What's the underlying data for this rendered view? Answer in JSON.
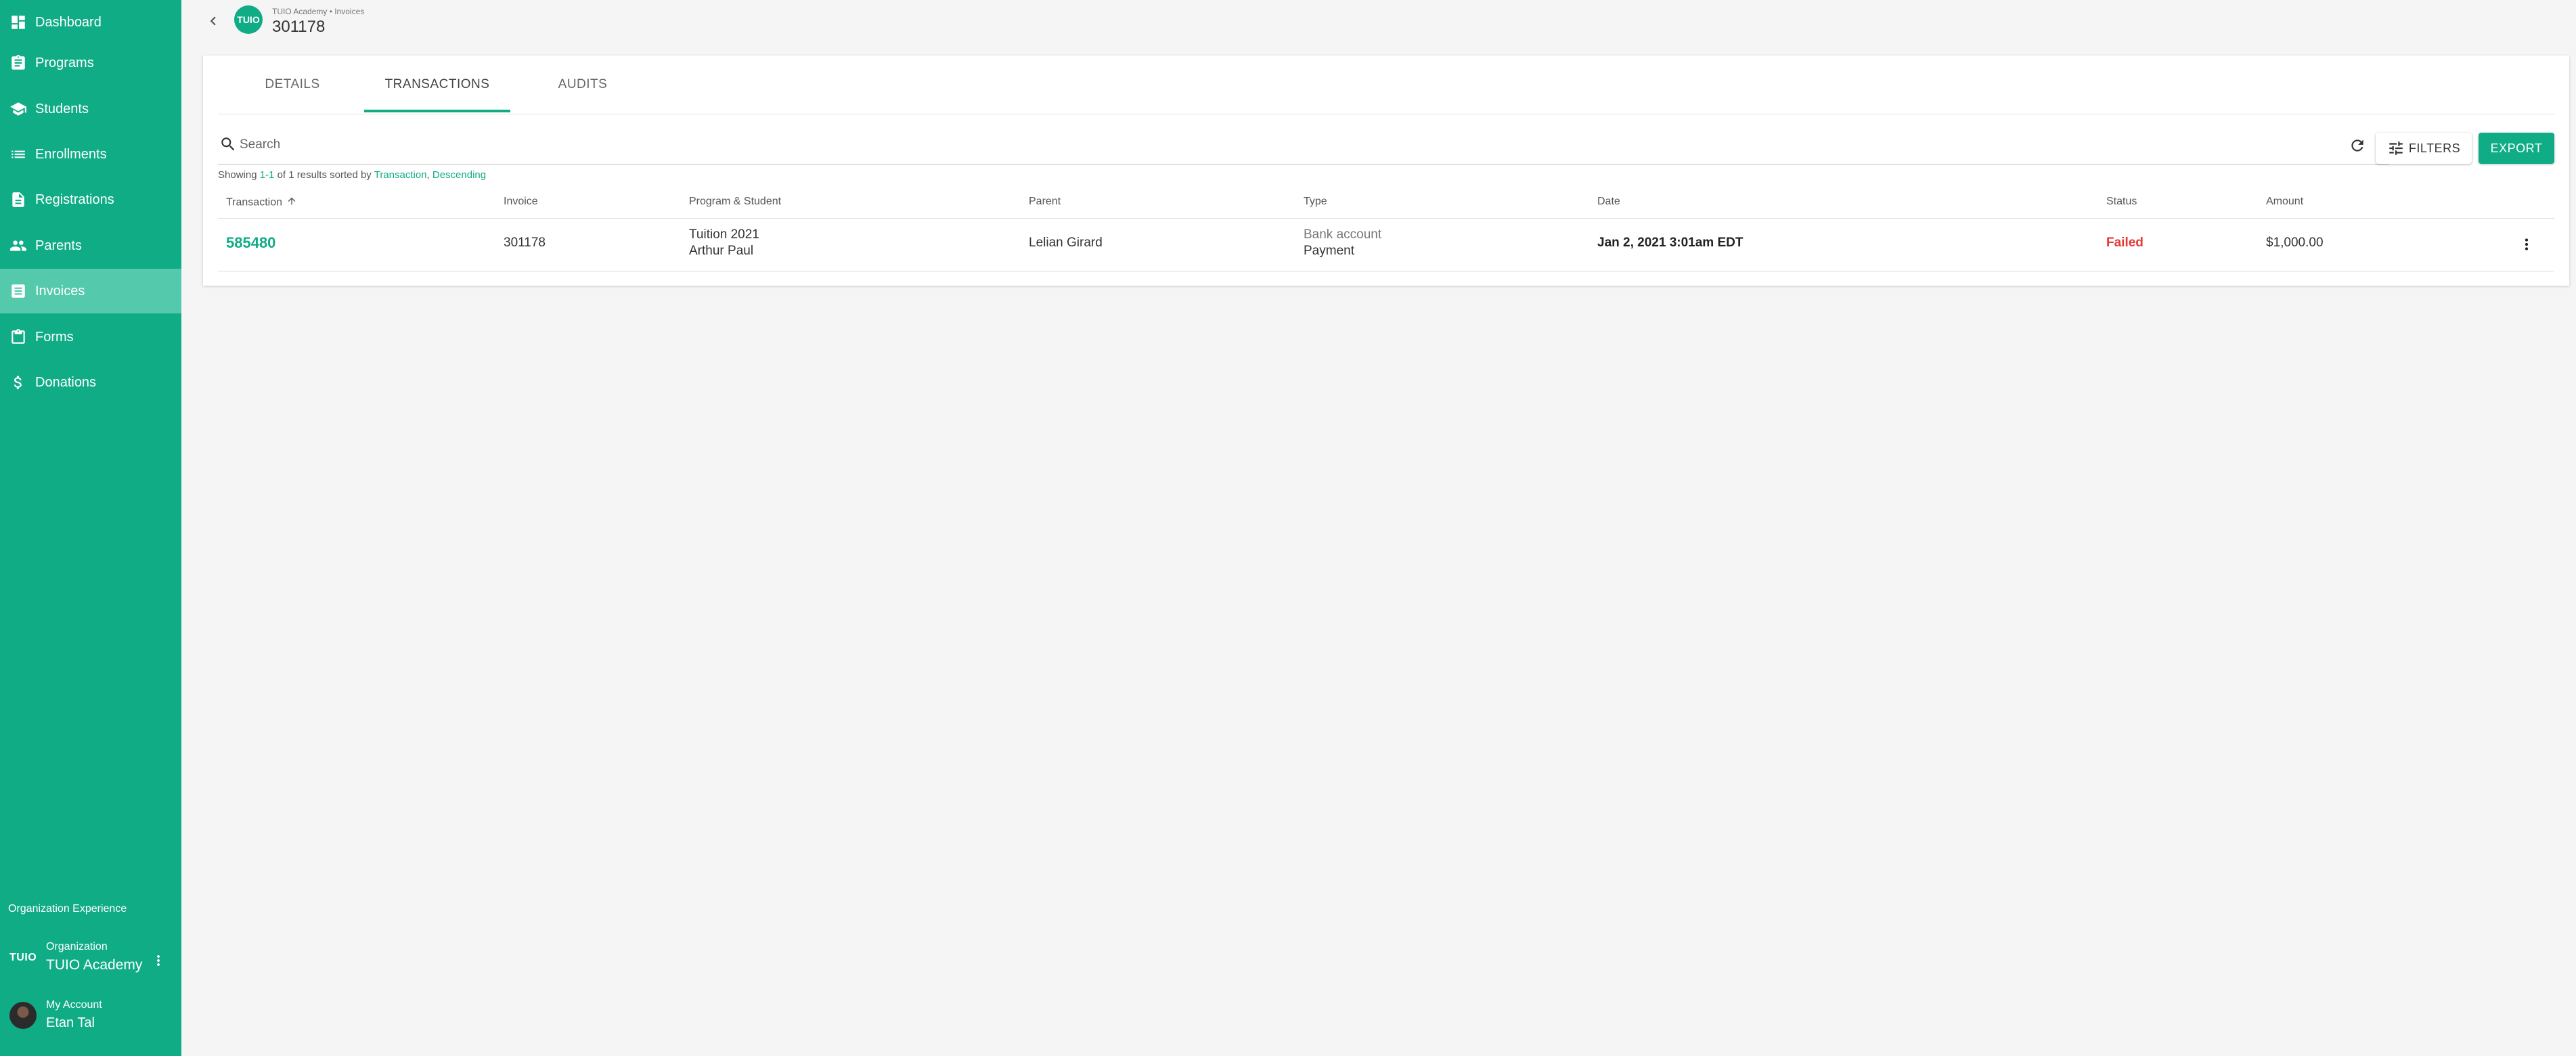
{
  "sidebar": {
    "items": [
      {
        "label": "Dashboard",
        "icon": "dashboard-icon"
      },
      {
        "label": "Programs",
        "icon": "clipboard-icon"
      },
      {
        "label": "Students",
        "icon": "school-icon"
      },
      {
        "label": "Enrollments",
        "icon": "list-icon"
      },
      {
        "label": "Registrations",
        "icon": "document-icon"
      },
      {
        "label": "Parents",
        "icon": "people-icon"
      },
      {
        "label": "Invoices",
        "icon": "receipt-icon"
      },
      {
        "label": "Forms",
        "icon": "form-icon"
      },
      {
        "label": "Donations",
        "icon": "dollar-icon"
      }
    ],
    "active_item": "Invoices",
    "org_experience_label": "Organization Experience",
    "org": {
      "logo_text": "TUIO",
      "small_label": "Organization",
      "name": "TUIO Academy"
    },
    "account": {
      "small_label": "My Account",
      "name": "Etan Tal"
    }
  },
  "header": {
    "logo_text": "TUIO",
    "breadcrumb": "TUIO Academy • Invoices",
    "title": "301178"
  },
  "tabs": [
    {
      "label": "DETAILS",
      "active": false
    },
    {
      "label": "TRANSACTIONS",
      "active": true
    },
    {
      "label": "AUDITS",
      "active": false
    }
  ],
  "search": {
    "placeholder": "Search",
    "value": ""
  },
  "toolbar": {
    "filters_label": "FILTERS",
    "export_label": "EXPORT"
  },
  "results": {
    "prefix": "Showing ",
    "range": "1-1",
    "middle": " of 1 results sorted by ",
    "sort_field": "Transaction",
    "separator": ", ",
    "sort_direction": "Descending"
  },
  "table": {
    "columns": [
      "Transaction",
      "Invoice",
      "Program & Student",
      "Parent",
      "Type",
      "Date",
      "Status",
      "Amount"
    ],
    "rows": [
      {
        "transaction": "585480",
        "invoice": "301178",
        "program": "Tuition 2021",
        "student": "Arthur Paul",
        "parent": "Lelian Girard",
        "type_method": "Bank account",
        "type_kind": "Payment",
        "date": "Jan 2, 2021 3:01am EDT",
        "status": "Failed",
        "amount": "$1,000.00"
      }
    ]
  },
  "colors": {
    "accent": "#0fac85",
    "active_nav": "#54c9ab",
    "status_failed": "#e53935"
  }
}
